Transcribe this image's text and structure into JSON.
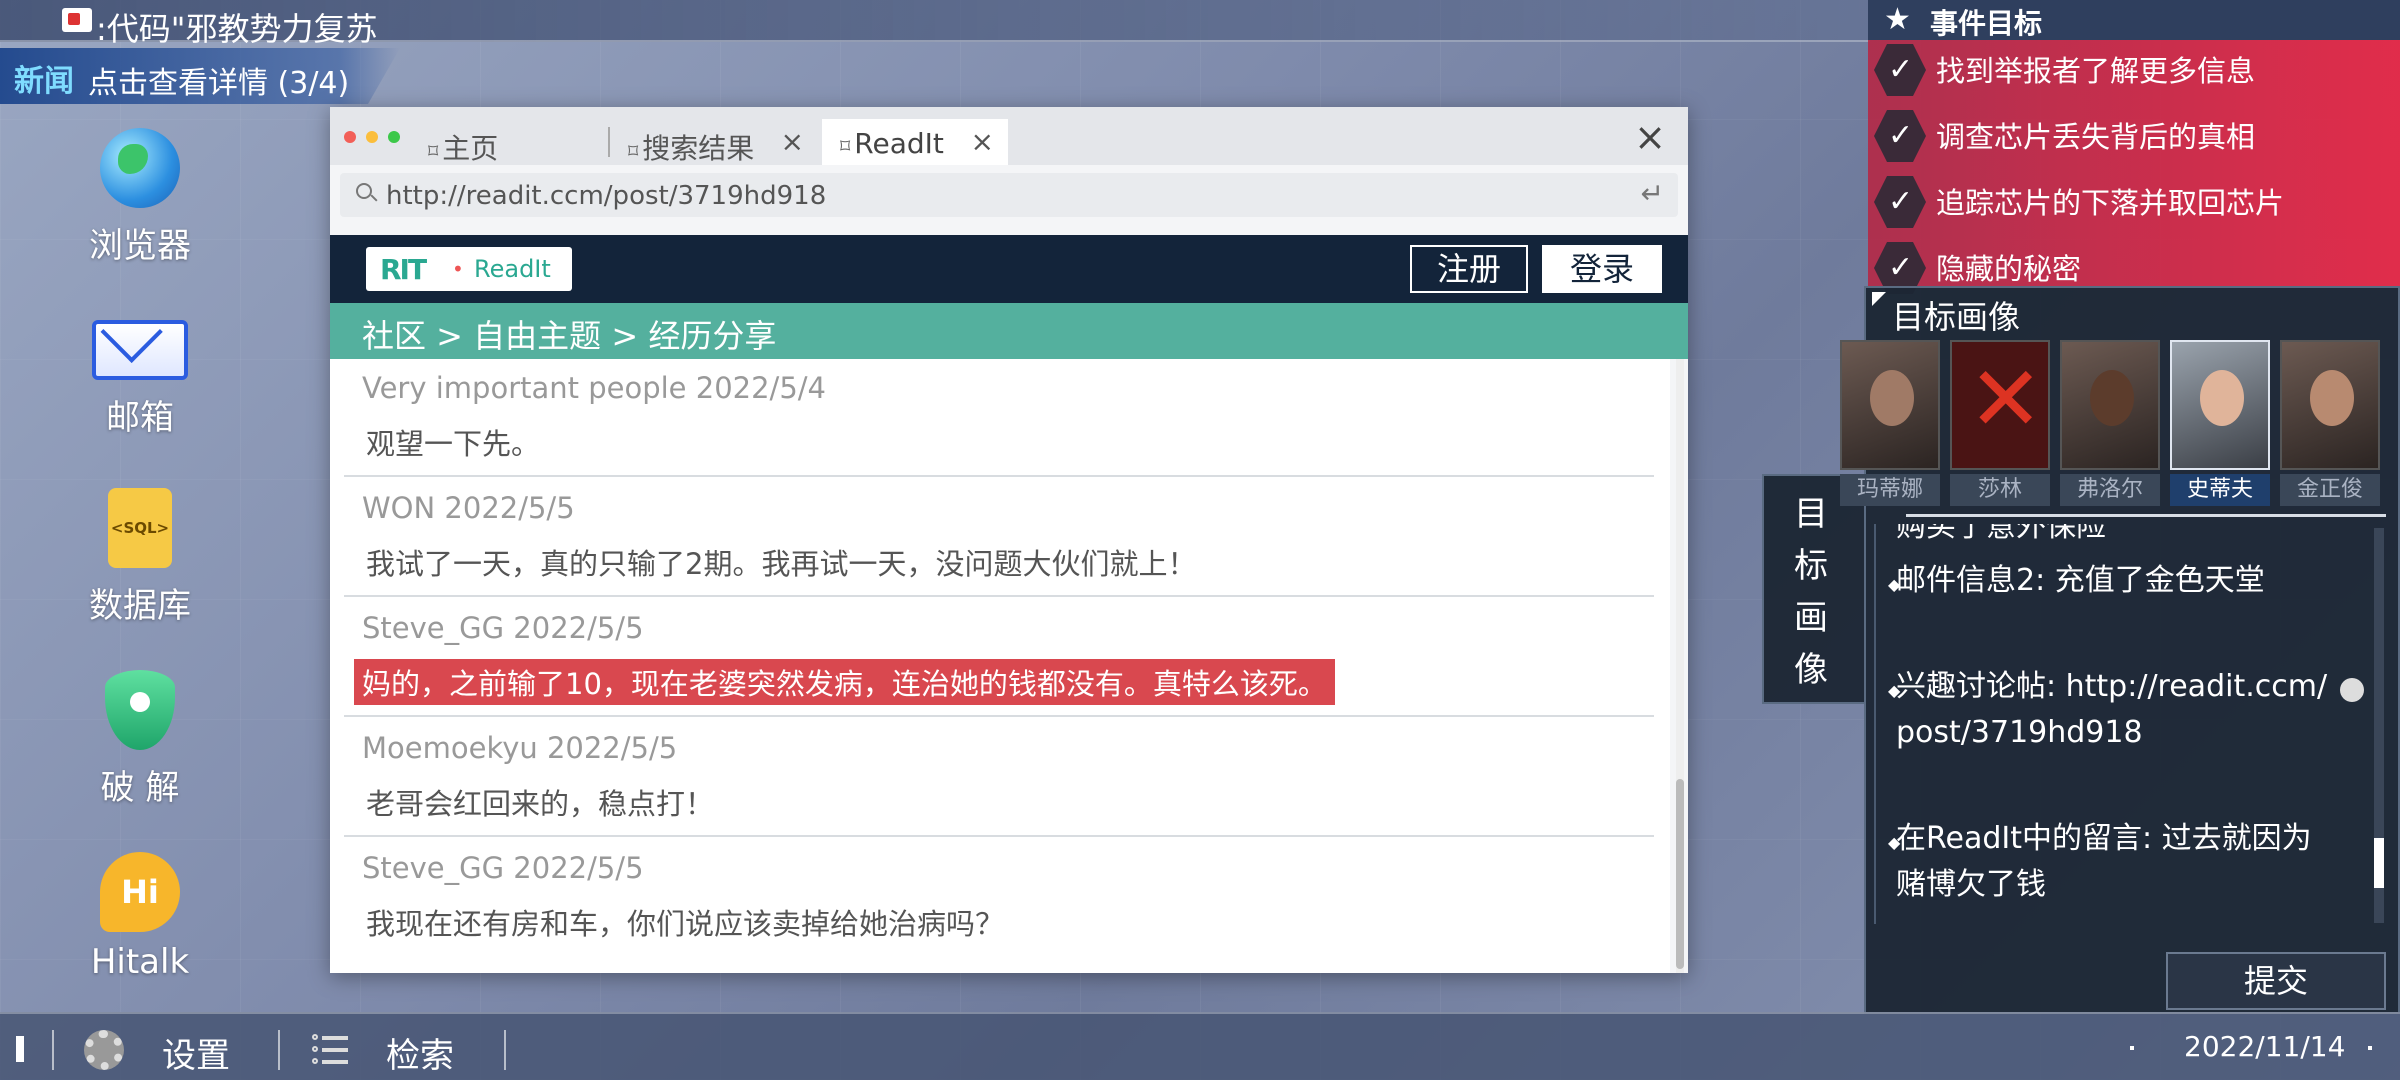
{
  "topbar": {
    "title": ":代码\"邪教势力复苏"
  },
  "news": {
    "tag": "新闻",
    "text": "点击查看详情 (3/4)"
  },
  "desktop": [
    {
      "label": "浏览器",
      "icon": "globe-icon"
    },
    {
      "label": "邮箱",
      "icon": "mail-icon"
    },
    {
      "label": "数据库",
      "icon": "sql-database-icon",
      "icon_text": "<SQL>"
    },
    {
      "label": "破 解",
      "icon": "shield-icon"
    },
    {
      "label": "Hitalk",
      "icon": "hitalk-icon",
      "icon_text": "Hi"
    }
  ],
  "browser": {
    "tabs": [
      {
        "label": "主页"
      },
      {
        "label": "搜索结果",
        "close": "×"
      },
      {
        "label": "ReadIt",
        "close": "×"
      }
    ],
    "close": "×",
    "url": "http://readit.ccm/post/3719hd918",
    "url_enter": "↵",
    "site": {
      "logo_mark": "RIT",
      "logo_dot": "•",
      "logo_name": "ReadIt",
      "register": "注册",
      "login": "登录"
    },
    "breadcrumb": "社区 > 自由主题 > 经历分享",
    "posts": [
      {
        "meta": "Very important people  2022/5/4",
        "body": "观望一下先。"
      },
      {
        "meta": "WON  2022/5/5",
        "body": "我试了一天，真的只输了2期。我再试一天，没问题大伙们就上！"
      },
      {
        "meta": "Steve_GG  2022/5/5",
        "body": "妈的，之前输了10，现在老婆突然发病，连治她的钱都没有。真特么该死。",
        "highlighted": true
      },
      {
        "meta": "Moemoekyu  2022/5/5",
        "body": "老哥会红回来的，稳点打！"
      },
      {
        "meta": "Steve_GG  2022/5/5",
        "body": "我现在还有房和车，你们说应该卖掉给她治病吗？"
      }
    ]
  },
  "goals": {
    "title": "事件目标",
    "items": [
      "找到举报者了解更多信息",
      "调查芯片丢失背后的真相",
      "追踪芯片的下落并取回芯片",
      "隐藏的秘密"
    ]
  },
  "profile": {
    "title": "目标画像",
    "side_tab": [
      "目",
      "标",
      "画",
      "像"
    ],
    "people": [
      {
        "name": "玛蒂娜",
        "crossed": false,
        "selected": false
      },
      {
        "name": "莎林",
        "crossed": true,
        "selected": false
      },
      {
        "name": "弗洛尔",
        "crossed": false,
        "selected": false
      },
      {
        "name": "史蒂夫",
        "crossed": false,
        "selected": true
      },
      {
        "name": "金正俊",
        "crossed": false,
        "selected": false
      }
    ],
    "clue_cut": "购买了意外保险",
    "clues": [
      "邮件信息2: 充值了金色天堂",
      "兴趣讨论帖: http://readit.ccm/post/3719hd918",
      "在ReadIt中的留言: 过去就因为赌博欠了钱"
    ],
    "submit": "提交"
  },
  "taskbar": {
    "settings": "设置",
    "search": "检索",
    "date": "2022/11/14"
  }
}
